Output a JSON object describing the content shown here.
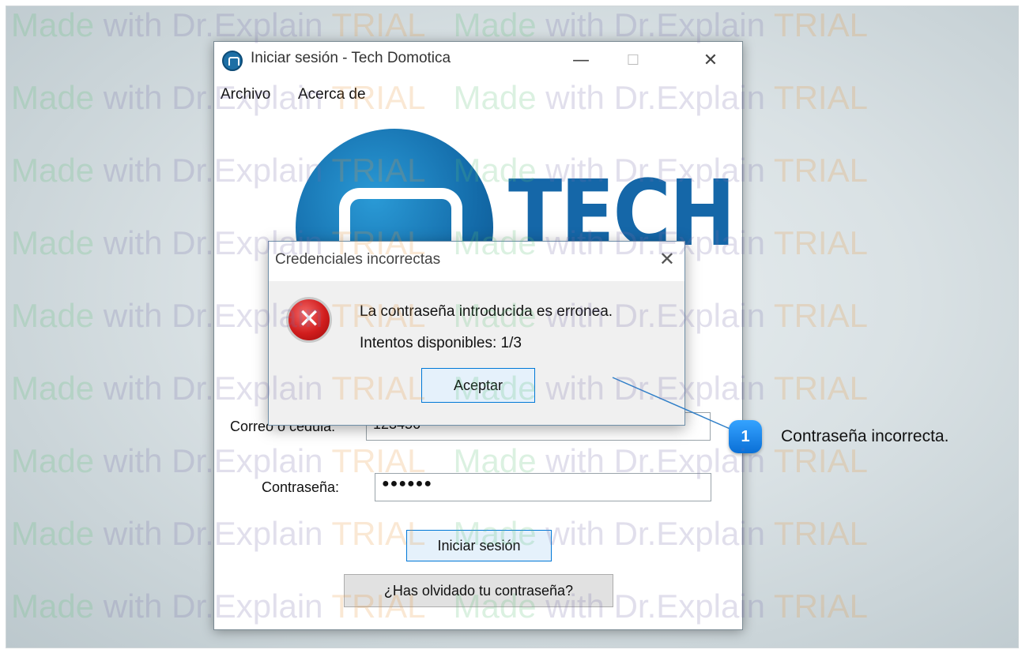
{
  "window": {
    "title": "Iniciar sesión - Tech Domotica",
    "controls": {
      "minimize": "—",
      "maximize": "☐",
      "close": "✕"
    },
    "menu": [
      "Archivo",
      "Acerca de"
    ]
  },
  "logo": {
    "text": "TECH",
    "color": "#1567a8"
  },
  "form": {
    "user_label": "Correo o cedula:",
    "user_value": "123456",
    "password_label": "Contraseña:",
    "password_value": "●●●●●●",
    "login_button": "Iniciar sesión",
    "forgot_button": "¿Has olvidado tu contraseña?"
  },
  "dialog": {
    "title": "Credenciales incorrectas",
    "close": "✕",
    "icon": "error-icon",
    "message_line1": "La contraseña introducida es erronea.",
    "message_line2": "Intentos disponibles: 1/3",
    "accept_button": "Aceptar"
  },
  "callout": {
    "number": "1",
    "text": "Contraseña incorrecta."
  },
  "watermark": {
    "made": "Made",
    "with": "with Dr.Explain",
    "trial": "TRIAL"
  }
}
